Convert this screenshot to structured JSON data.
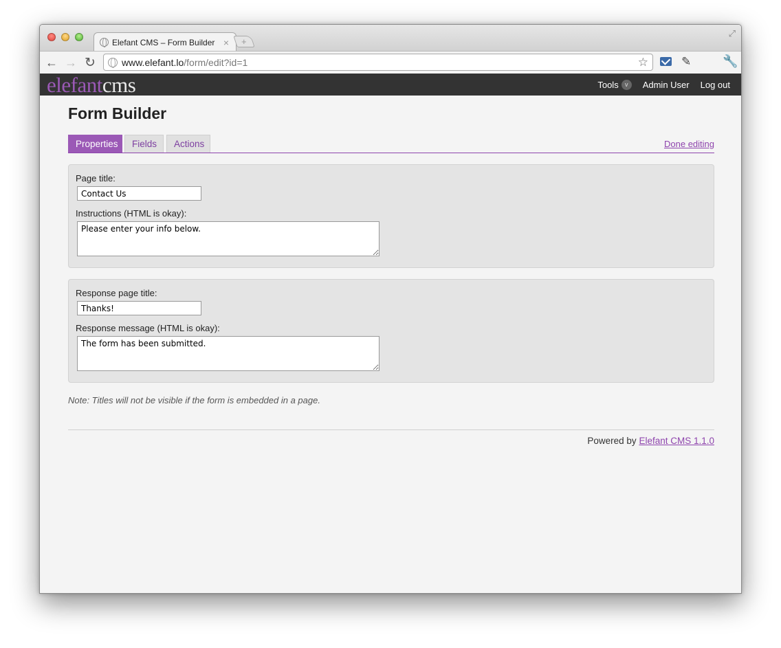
{
  "browser": {
    "tab_title": "Elefant CMS – Form Builder",
    "url_host": "www.elefant.lo",
    "url_path": "/form/edit?id=1"
  },
  "cms": {
    "logo_primary": "elefant",
    "logo_secondary": "cms",
    "nav": {
      "tools": "Tools",
      "tools_badge": "v",
      "user": "Admin User",
      "logout": "Log out"
    }
  },
  "page": {
    "title": "Form Builder",
    "tabs": [
      {
        "label": "Properties",
        "active": true
      },
      {
        "label": "Fields",
        "active": false
      },
      {
        "label": "Actions",
        "active": false
      }
    ],
    "done_link": "Done editing"
  },
  "form": {
    "page_title_label": "Page title:",
    "page_title_value": "Contact Us",
    "instructions_label": "Instructions (HTML is okay):",
    "instructions_value": "Please enter your info below.",
    "response_title_label": "Response page title:",
    "response_title_value": "Thanks!",
    "response_message_label": "Response message (HTML is okay):",
    "response_message_value": "The form has been submitted."
  },
  "note": "Note: Titles will not be visible if the form is embedded in a page.",
  "footer": {
    "powered_by": "Powered by",
    "link": "Elefant CMS 1.1.0"
  },
  "colors": {
    "accent": "#9b59b6",
    "header_bg": "#333333",
    "panel_bg": "#e4e4e4"
  }
}
